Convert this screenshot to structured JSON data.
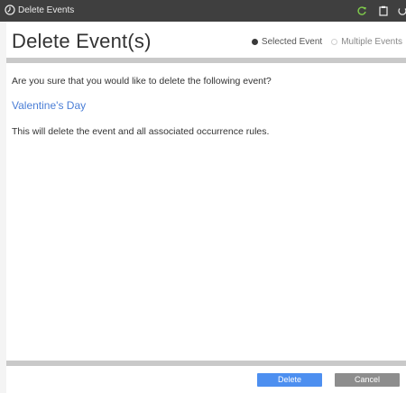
{
  "window": {
    "title": "Delete Events",
    "icons": [
      "clock-icon",
      "refresh-icon",
      "clipboard-icon",
      "power-icon"
    ]
  },
  "header": {
    "title": "Delete Event(s)",
    "options": [
      {
        "label": "Selected Event",
        "selected": true
      },
      {
        "label": "Multiple Events",
        "selected": false
      }
    ]
  },
  "content": {
    "question": "Are you sure that you would like to delete the following event?",
    "event_name": "Valentine's Day",
    "note": "This will delete the event and all associated occurrence rules."
  },
  "footer": {
    "delete_label": "Delete",
    "cancel_label": "Cancel"
  },
  "colors": {
    "titlebar": "#3f3f3f",
    "link": "#4a7ed6",
    "primary_button": "#4d8ff0",
    "secondary_button": "#8d8d8d",
    "separator": "#c9c9c9"
  }
}
